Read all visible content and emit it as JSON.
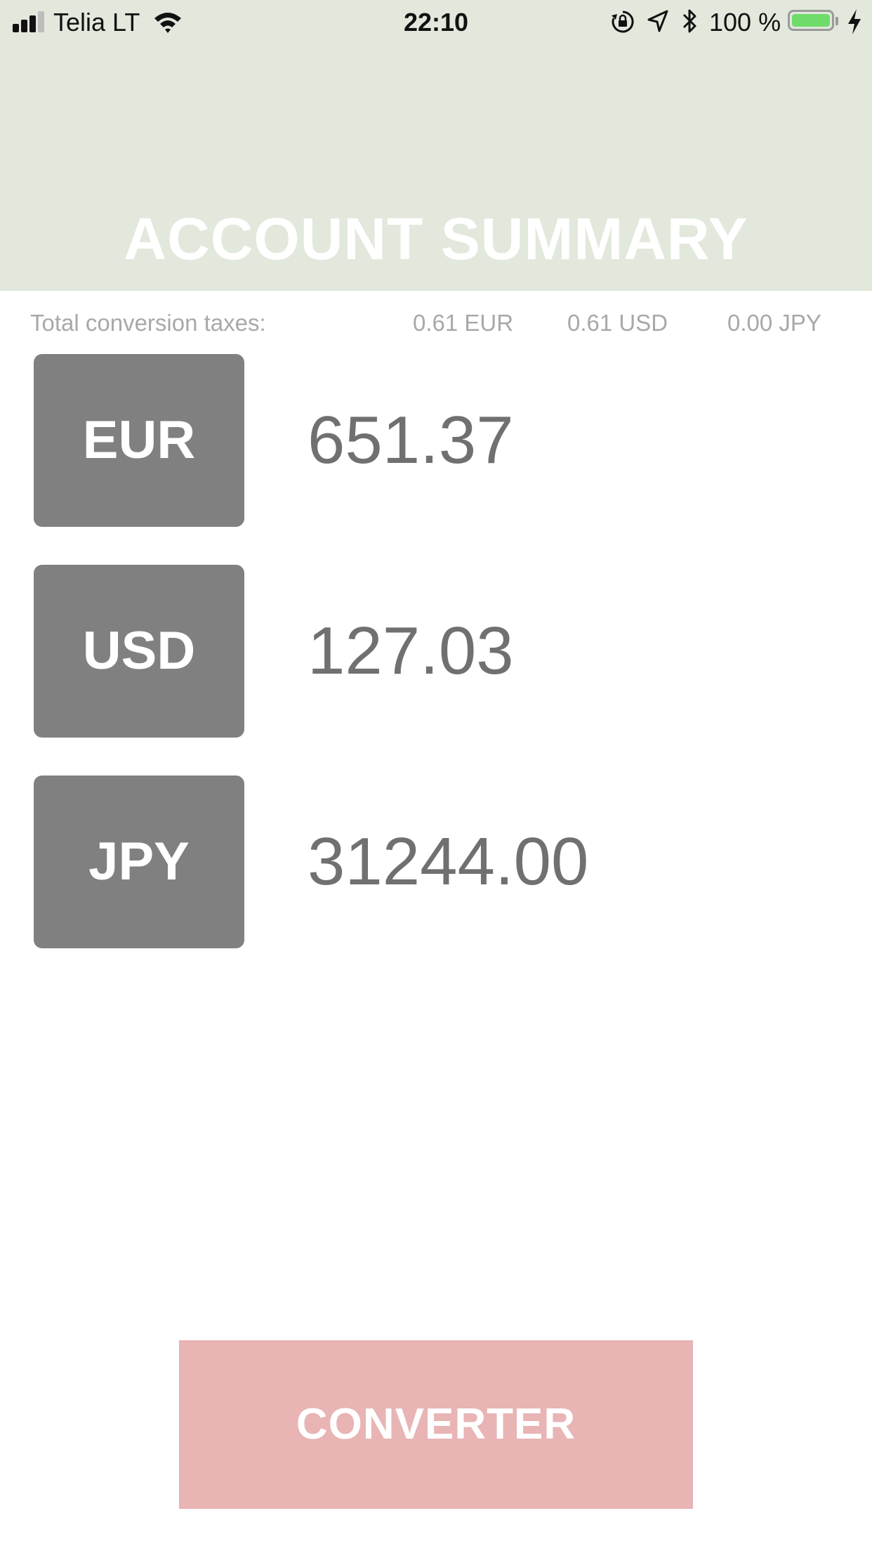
{
  "status_bar": {
    "carrier": "Telia LT",
    "time": "22:10",
    "battery_percent": "100 %",
    "battery_level": 1.0,
    "battery_color": "#6fdc6a"
  },
  "header": {
    "title": "ACCOUNT SUMMARY",
    "background": "#e2e8dc"
  },
  "taxes": {
    "label": "Total conversion taxes:",
    "eur": "0.61 EUR",
    "usd": "0.61 USD",
    "jpy": "0.00 JPY"
  },
  "balances": [
    {
      "currency": "EUR",
      "amount": "651.37"
    },
    {
      "currency": "USD",
      "amount": "127.03"
    },
    {
      "currency": "JPY",
      "amount": "31244.00"
    }
  ],
  "converter_button": {
    "label": "CONVERTER",
    "color": "#e8b4b4"
  }
}
